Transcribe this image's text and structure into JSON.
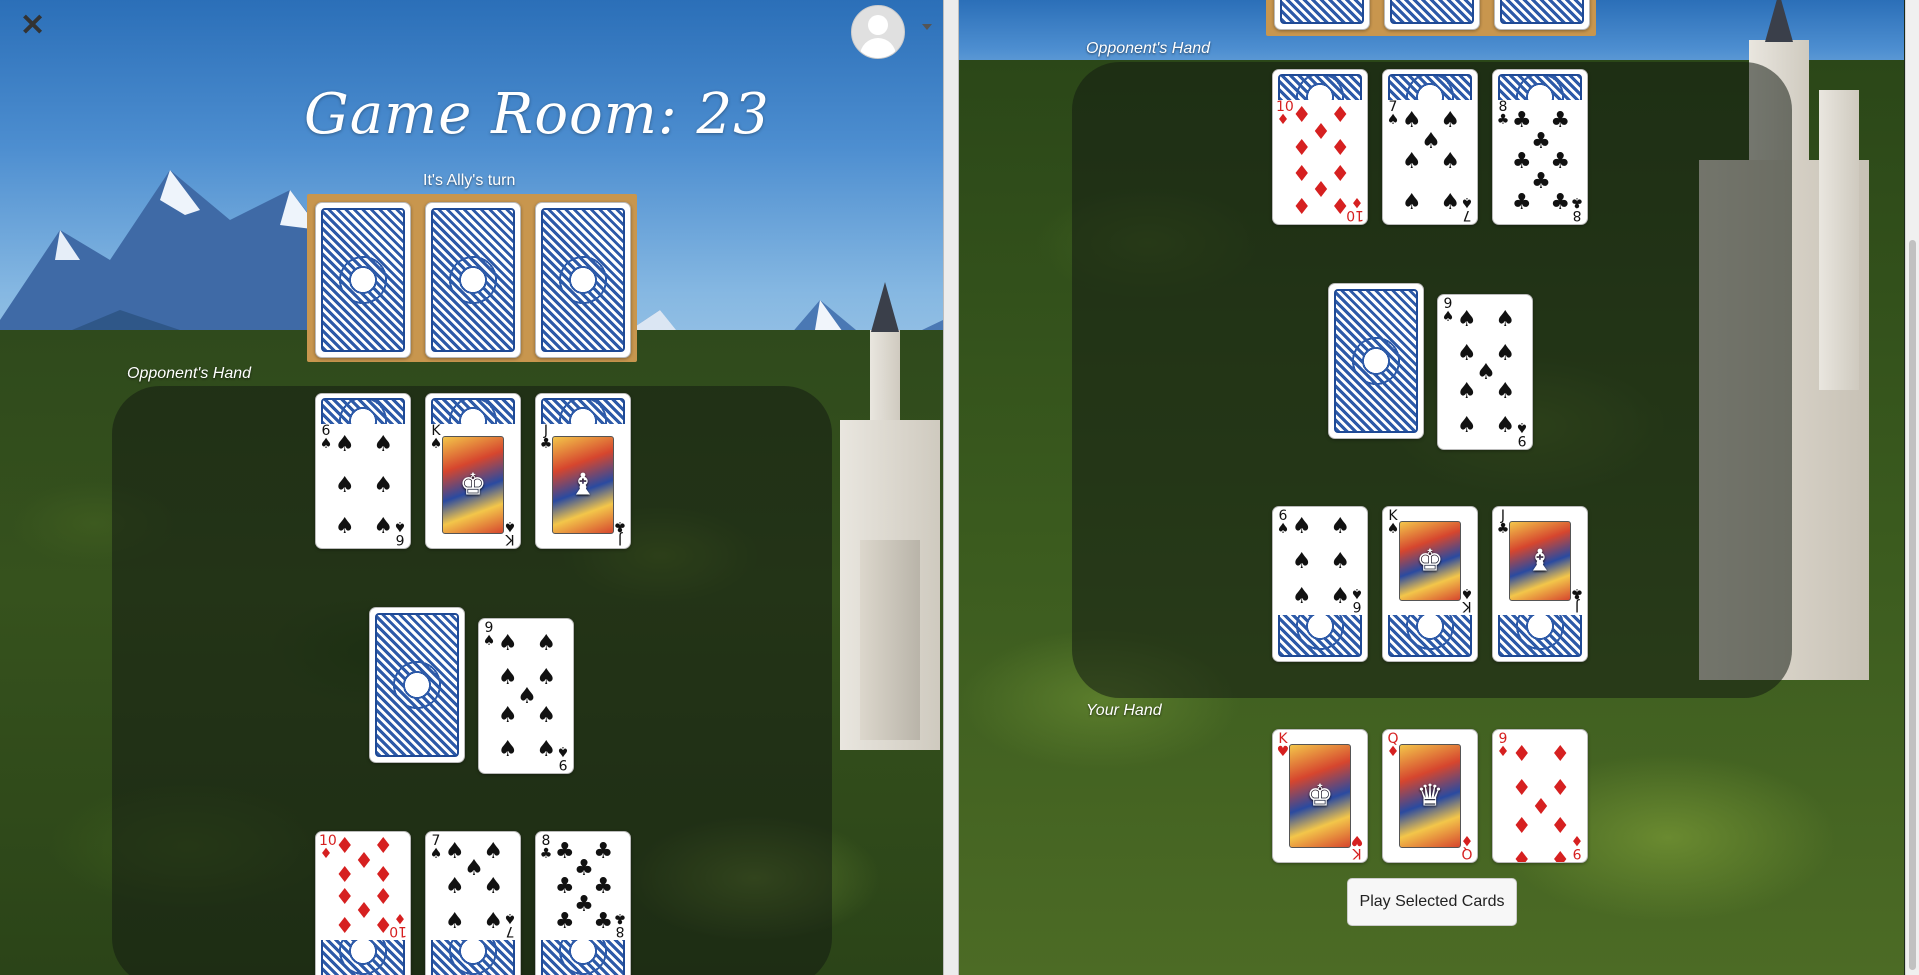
{
  "left": {
    "room_title": "Game Room: 23",
    "turn_text": "It's Ally's turn",
    "opponent_label": "Opponent's Hand"
  },
  "right": {
    "opponent_label": "Opponent's Hand",
    "your_hand_label": "Your Hand",
    "play_button": "Play Selected Cards"
  },
  "cards": {
    "left_opponent_faceup": [
      {
        "rank": "6",
        "suit": "♠",
        "color": "black"
      },
      {
        "rank": "K",
        "suit": "♠",
        "color": "black"
      },
      {
        "rank": "J",
        "suit": "♣",
        "color": "black"
      }
    ],
    "left_middle_faceup": {
      "rank": "9",
      "suit": "♠",
      "color": "black"
    },
    "left_bottom": [
      {
        "rank": "10",
        "suit": "♦",
        "color": "red"
      },
      {
        "rank": "7",
        "suit": "♠",
        "color": "black"
      },
      {
        "rank": "8",
        "suit": "♣",
        "color": "black"
      }
    ],
    "right_opponent_faceup": [
      {
        "rank": "10",
        "suit": "♦",
        "color": "red"
      },
      {
        "rank": "7",
        "suit": "♠",
        "color": "black"
      },
      {
        "rank": "8",
        "suit": "♣",
        "color": "black"
      }
    ],
    "right_middle_faceup": {
      "rank": "9",
      "suit": "♠",
      "color": "black"
    },
    "right_lower": [
      {
        "rank": "6",
        "suit": "♠",
        "color": "black"
      },
      {
        "rank": "K",
        "suit": "♠",
        "color": "black"
      },
      {
        "rank": "J",
        "suit": "♣",
        "color": "black"
      }
    ],
    "your_hand": [
      {
        "rank": "K",
        "suit": "♥",
        "color": "red"
      },
      {
        "rank": "Q",
        "suit": "♦",
        "color": "red"
      },
      {
        "rank": "9",
        "suit": "♦",
        "color": "red"
      }
    ]
  },
  "colors": {
    "tray": "#c8964e",
    "card_back": "#2d5aa8",
    "red_suit": "#d62020"
  },
  "icons": [
    "close-icon",
    "avatar-icon",
    "caret-down-icon"
  ]
}
